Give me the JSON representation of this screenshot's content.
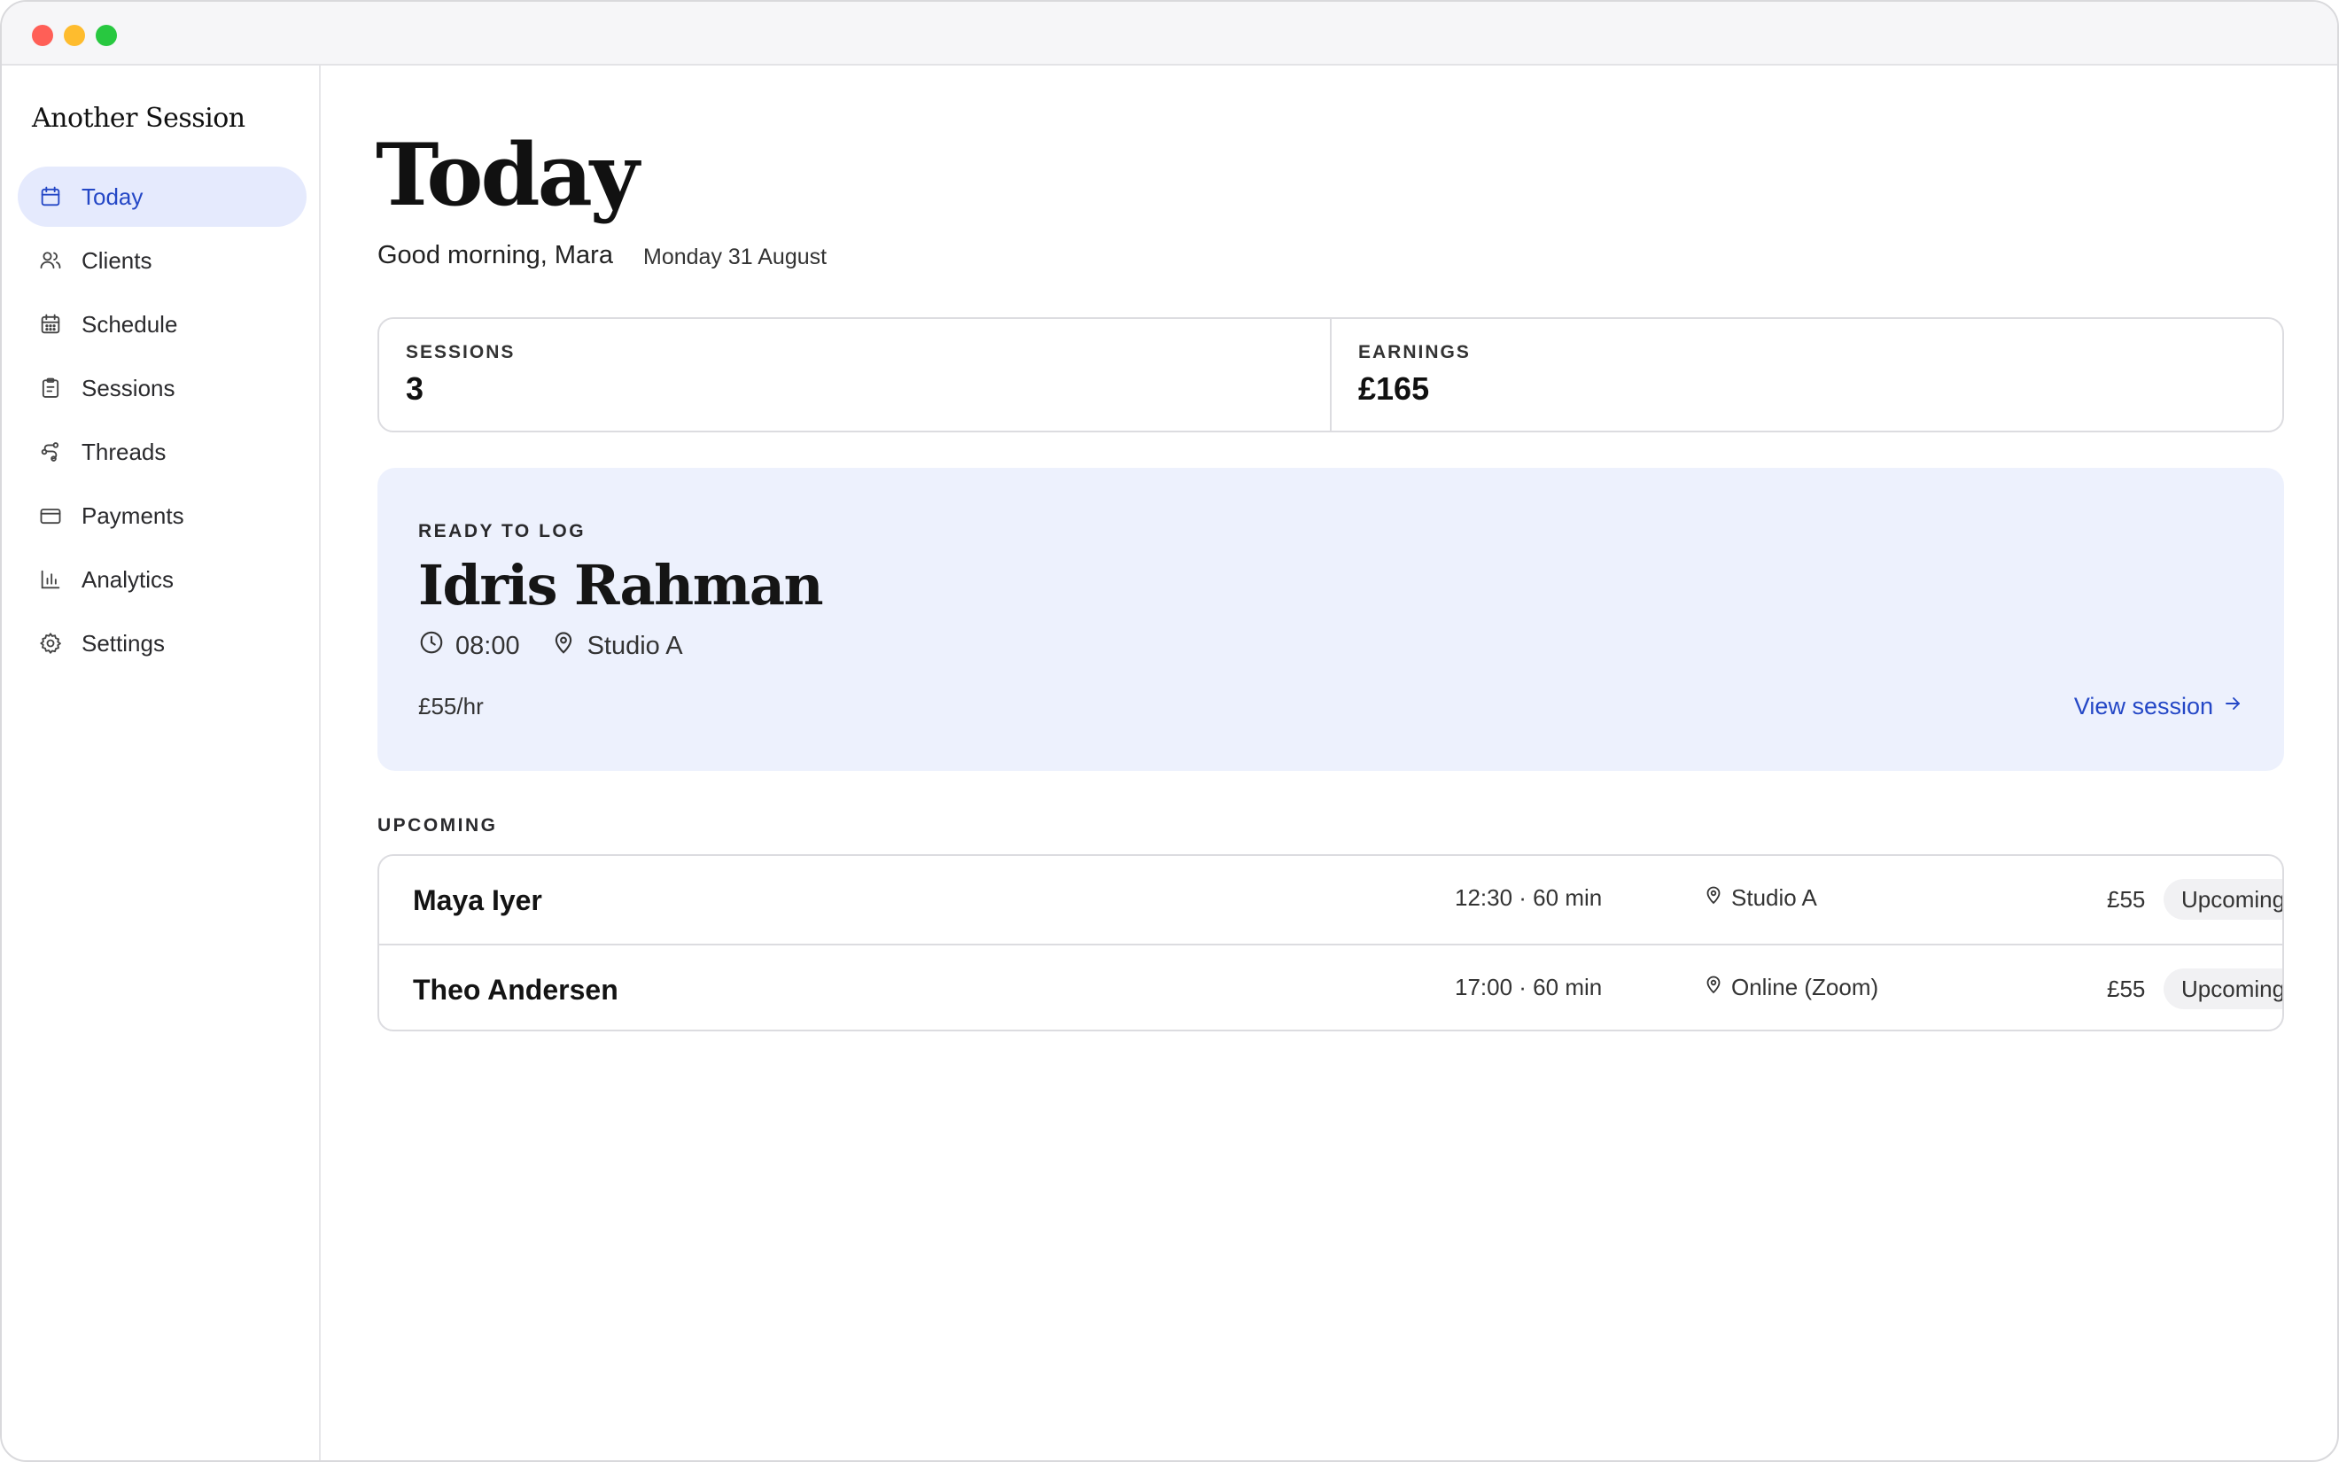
{
  "app": {
    "name": "Another Session"
  },
  "sidebar": {
    "items": [
      {
        "label": "Today",
        "icon": "calendar-icon",
        "active": true
      },
      {
        "label": "Clients",
        "icon": "users-icon",
        "active": false
      },
      {
        "label": "Schedule",
        "icon": "calendar-grid-icon",
        "active": false
      },
      {
        "label": "Sessions",
        "icon": "clipboard-icon",
        "active": false
      },
      {
        "label": "Threads",
        "icon": "threads-icon",
        "active": false
      },
      {
        "label": "Payments",
        "icon": "card-icon",
        "active": false
      },
      {
        "label": "Analytics",
        "icon": "bar-chart-icon",
        "active": false
      },
      {
        "label": "Settings",
        "icon": "gear-icon",
        "active": false
      }
    ]
  },
  "page": {
    "title": "Today",
    "greeting": "Good morning, Mara",
    "date": "Monday 31 August"
  },
  "stats": {
    "sessions_label": "SESSIONS",
    "sessions_value": "3",
    "earnings_label": "EARNINGS",
    "earnings_value": "£165"
  },
  "ready": {
    "label": "READY TO LOG",
    "client": "Idris Rahman",
    "time": "08:00",
    "location": "Studio A",
    "rate": "£55/hr",
    "action": "View session"
  },
  "upcoming": {
    "label": "UPCOMING",
    "rows": [
      {
        "name": "Maya Iyer",
        "time": "12:30 · 60 min",
        "location": "Studio A",
        "price": "£55",
        "status": "Upcoming"
      },
      {
        "name": "Theo Andersen",
        "time": "17:00 · 60 min",
        "location": "Online (Zoom)",
        "price": "£55",
        "status": "Upcoming"
      }
    ]
  },
  "colors": {
    "accent": "#2447c6",
    "active_bg": "#e5eafd",
    "card_bg": "#edf1fd"
  }
}
